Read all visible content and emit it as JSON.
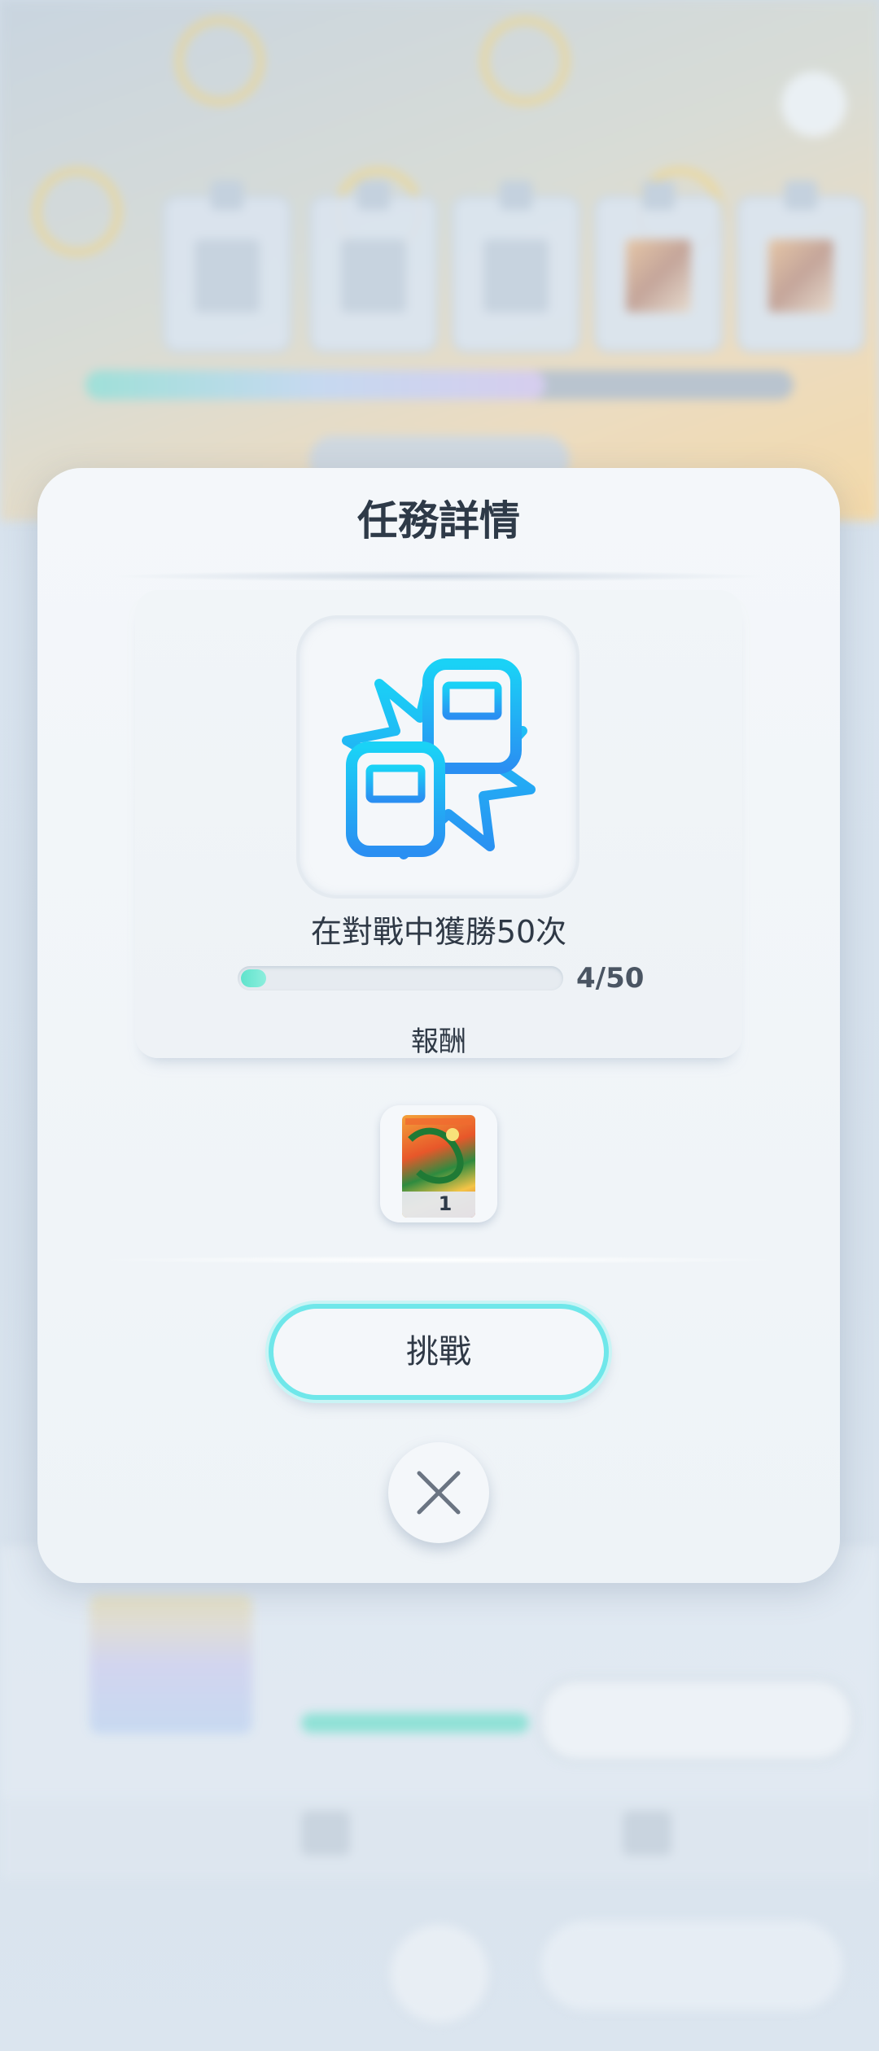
{
  "background": {
    "title": "",
    "bottom_tabs": [
      "",
      "",
      ""
    ],
    "bottom_button_label": ""
  },
  "modal": {
    "title": "任務詳情",
    "mission_icon": "battle-win-icon",
    "mission_description": "在對戰中獲勝50次",
    "progress": {
      "current": 4,
      "total": 50,
      "text": "4/50"
    },
    "reward_label": "報酬",
    "reward": {
      "item_icon": "card-icon",
      "count": "1"
    },
    "challenge_button_label": "挑戰",
    "close_icon": "close-icon"
  },
  "colors": {
    "accent_cyan": "#6fe7ea",
    "progress_fill": "#5fe3cc",
    "icon_blue": "#1fb7f5",
    "text_dark": "#2f3946"
  }
}
